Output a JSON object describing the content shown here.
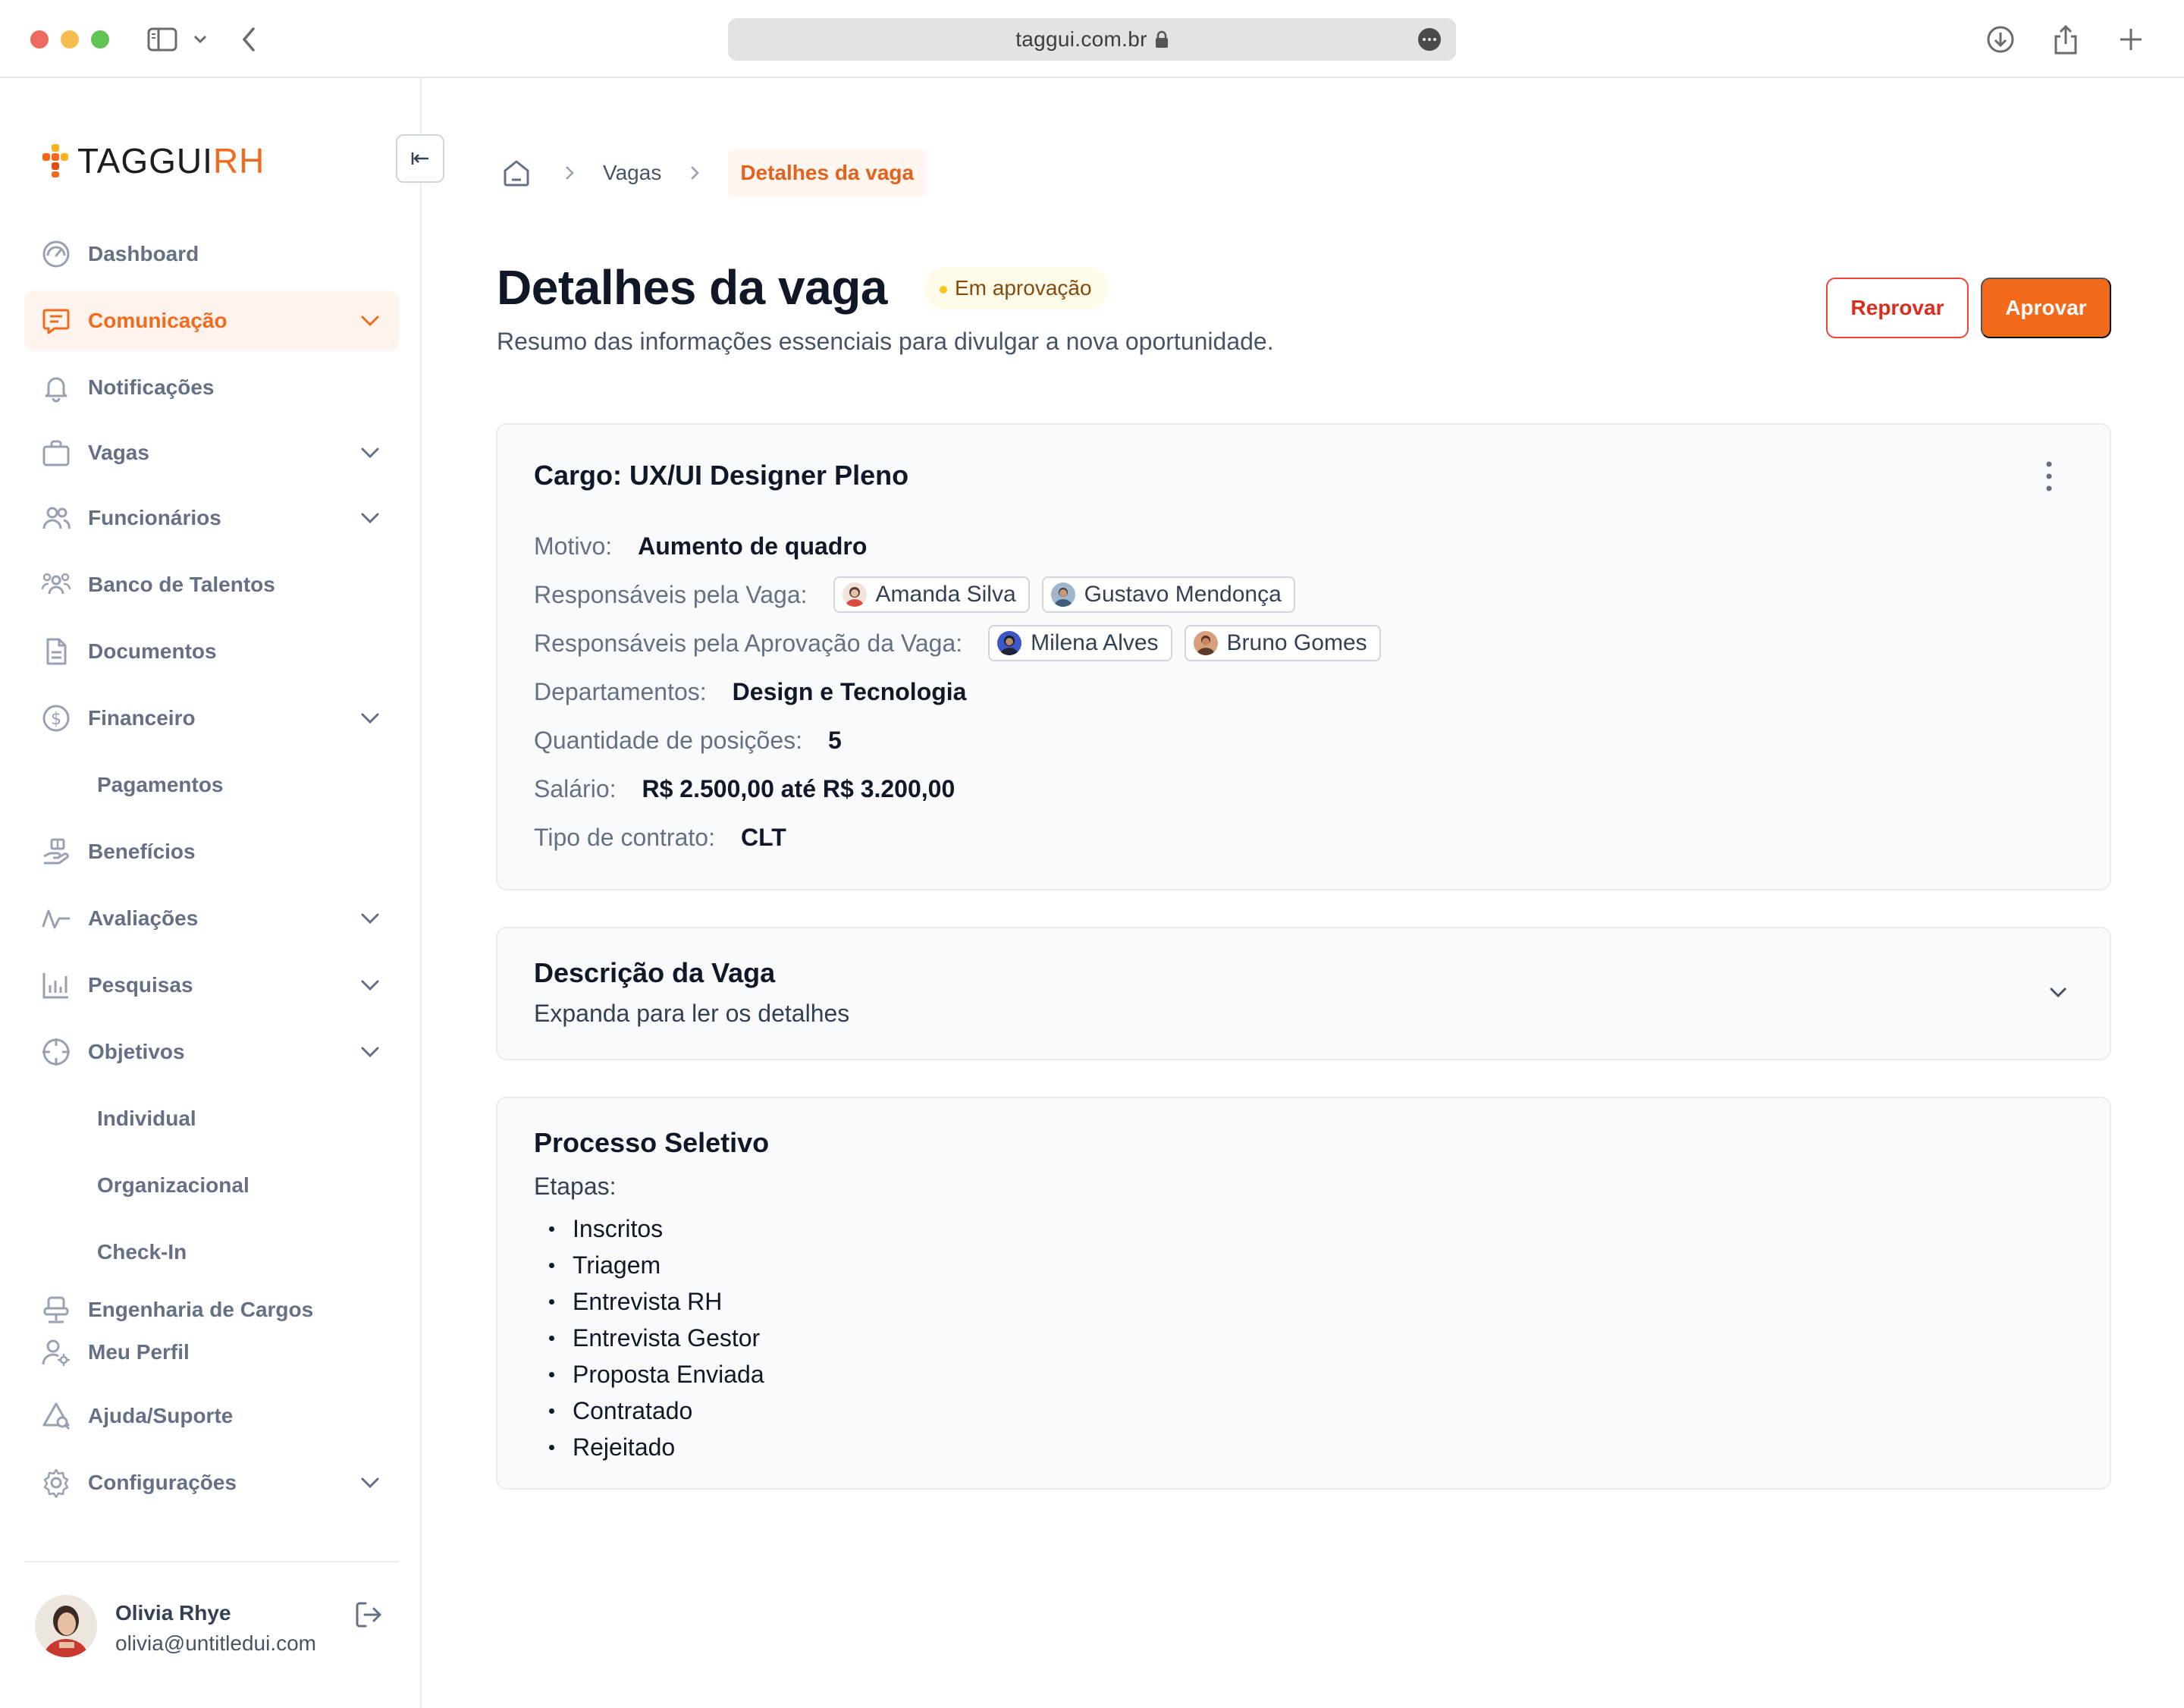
{
  "browser": {
    "url": "taggui.com.br"
  },
  "brand": {
    "name_primary": "TAGGUI",
    "name_accent": "RH",
    "accent_color": "#f26b1d"
  },
  "sidebar": {
    "items": [
      {
        "label": "Dashboard",
        "icon": "gauge-icon"
      },
      {
        "label": "Comunicação",
        "icon": "message-icon",
        "active": true,
        "expandable": true
      },
      {
        "label": "Notificações",
        "icon": "bell-icon"
      },
      {
        "label": "Vagas",
        "icon": "briefcase-icon",
        "expandable": true
      },
      {
        "label": "Funcionários",
        "icon": "users-icon",
        "expandable": true
      },
      {
        "label": "Banco de Talentos",
        "icon": "team-icon"
      },
      {
        "label": "Documentos",
        "icon": "document-icon"
      },
      {
        "label": "Financeiro",
        "icon": "dollar-icon",
        "expandable": true
      },
      {
        "label": "Pagamentos",
        "sub": true
      },
      {
        "label": "Benefícios",
        "icon": "gift-hand-icon"
      },
      {
        "label": "Avaliações",
        "icon": "activity-icon",
        "expandable": true
      },
      {
        "label": "Pesquisas",
        "icon": "bar-chart-icon",
        "expandable": true
      },
      {
        "label": "Objetivos",
        "icon": "target-icon",
        "expandable": true
      },
      {
        "label": "Individual",
        "sub": true
      },
      {
        "label": "Organizacional",
        "sub": true
      },
      {
        "label": "Check-In",
        "sub": true
      },
      {
        "label": "Engenharia de Cargos",
        "icon": "chair-icon"
      },
      {
        "label": "Meu Perfil",
        "icon": "user-gear-icon"
      },
      {
        "label": "Ajuda/Suporte",
        "icon": "help-search-icon"
      },
      {
        "label": "Configurações",
        "icon": "settings-icon",
        "expandable": true
      }
    ],
    "user": {
      "name": "Olivia Rhye",
      "email": "olivia@untitledui.com"
    }
  },
  "breadcrumb": {
    "items": [
      "Vagas",
      "Detalhes da vaga"
    ]
  },
  "header": {
    "title": "Detalhes da vaga",
    "status": "Em aprovação",
    "subtitle": "Resumo das informações essenciais para divulgar a nova oportunidade.",
    "reject_label": "Reprovar",
    "approve_label": "Aprovar"
  },
  "job": {
    "title": "Cargo: UX/UI Designer Pleno",
    "motivo_label": "Motivo:",
    "motivo": "Aumento de quadro",
    "responsaveis_label": "Responsáveis pela Vaga:",
    "responsaveis": [
      "Amanda Silva",
      "Gustavo Mendonça"
    ],
    "aprovacao_label": "Responsáveis pela Aprovação da Vaga:",
    "aprovadores": [
      "Milena Alves",
      "Bruno Gomes"
    ],
    "departamentos_label": "Departamentos:",
    "departamentos": "Design e Tecnologia",
    "quantidade_label": "Quantidade de posições:",
    "quantidade": "5",
    "salario_label": "Salário:",
    "salario": "R$ 2.500,00 até R$ 3.200,00",
    "contrato_label": "Tipo de contrato:",
    "contrato": "CLT"
  },
  "description": {
    "title": "Descrição da Vaga",
    "hint": "Expanda para ler os detalhes"
  },
  "process": {
    "title": "Processo Seletivo",
    "steps_label": "Etapas:",
    "steps": [
      "Inscritos",
      "Triagem",
      "Entrevista RH",
      "Entrevista Gestor",
      "Proposta Enviada",
      "Contratado",
      "Rejeitado"
    ]
  }
}
